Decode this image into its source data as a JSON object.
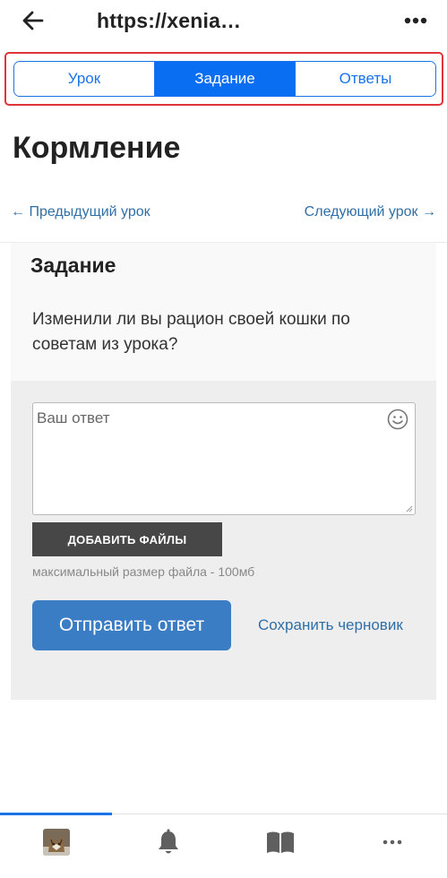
{
  "topbar": {
    "url": "https://xenia…",
    "back_icon": "arrow-left-icon",
    "menu_icon": "more-vertical-icon"
  },
  "tabs": [
    {
      "label": "Урок",
      "active": false
    },
    {
      "label": "Задание",
      "active": true
    },
    {
      "label": "Ответы",
      "active": false
    }
  ],
  "page": {
    "title": "Кормление"
  },
  "lesson_nav": {
    "prev": "← Предыдущий урок",
    "next": "Следующий урок →"
  },
  "task": {
    "heading": "Задание",
    "text": "Изменили ли вы рацион своей кошки по советам из урока?"
  },
  "answer": {
    "placeholder": "Ваш ответ",
    "value": "",
    "emoji_icon": "smiley-icon",
    "add_files_label": "ДОБАВИТЬ ФАЙЛЫ",
    "file_note": "максимальный размер файла - 100мб",
    "submit_label": "Отправить ответ",
    "draft_label": "Сохранить черновик"
  },
  "bottom_nav": [
    {
      "icon": "avatar",
      "active": true
    },
    {
      "icon": "bell-icon",
      "active": false
    },
    {
      "icon": "book-icon",
      "active": false
    },
    {
      "icon": "more-horizontal-icon",
      "active": false
    }
  ],
  "colors": {
    "accent": "#1a73e8",
    "active_tab": "#0a6ef2",
    "submit": "#3b7dc4",
    "link": "#2f6fa6",
    "highlight_frame": "#e0343a"
  }
}
